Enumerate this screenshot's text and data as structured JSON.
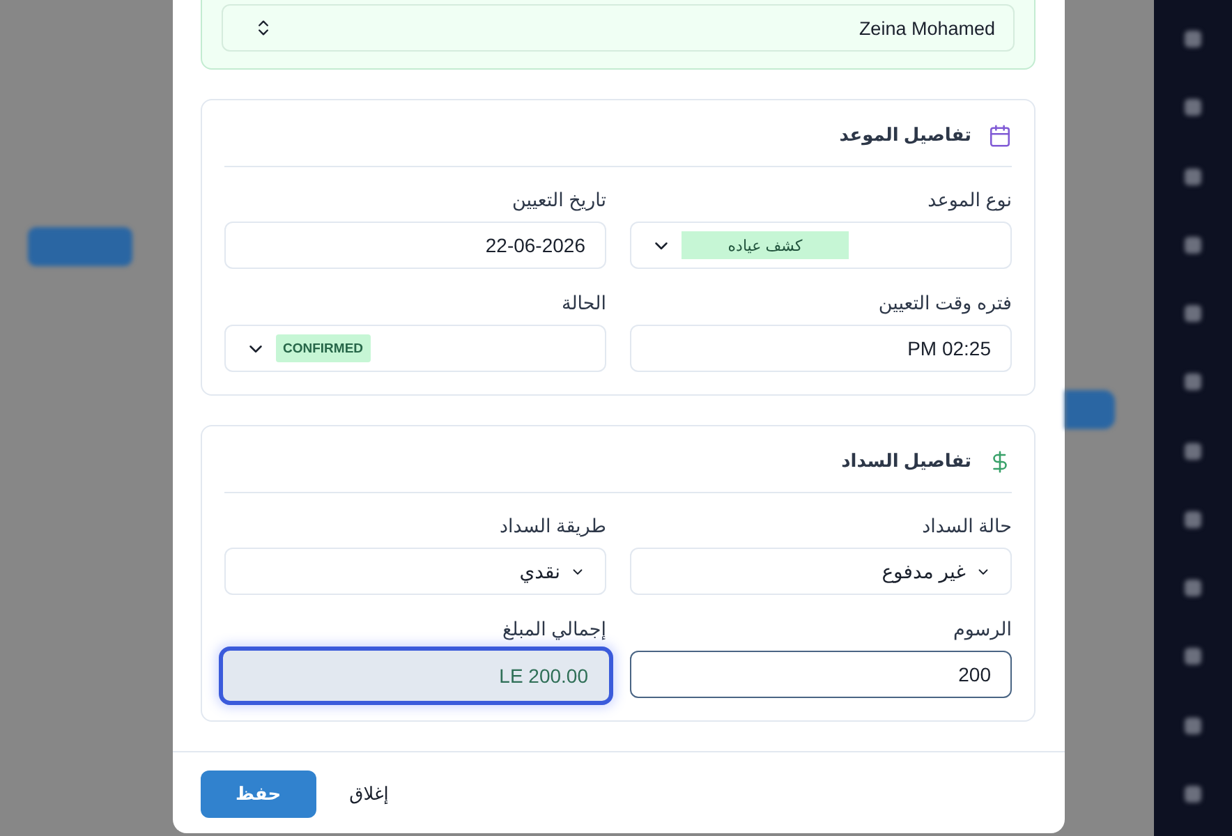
{
  "patient_select": {
    "value": "Zeina Mohamed"
  },
  "sections": [
    {
      "kind": "appointment",
      "title": "تفاصيل الموعد",
      "fields": [
        {
          "label": "نوع الموعد",
          "kind": "tag",
          "value": "كشف عياده",
          "readonly": false,
          "focused": false,
          "hovered": false
        },
        {
          "label": "تاريخ التعيين",
          "kind": "input",
          "value": "22-06-2026",
          "readonly": false,
          "focused": false,
          "hovered": false
        },
        {
          "label": "فتره وقت التعيين",
          "kind": "input",
          "value": "PM 02:25",
          "readonly": false,
          "focused": false,
          "hovered": false
        },
        {
          "label": "الحالة",
          "kind": "badge",
          "value": "CONFIRMED",
          "readonly": false,
          "focused": false,
          "hovered": false
        }
      ]
    },
    {
      "kind": "payment",
      "title": "تفاصيل السداد",
      "fields": [
        {
          "label": "حالة السداد",
          "kind": "select",
          "value": "غير مدفوع",
          "readonly": false,
          "focused": false,
          "hovered": false
        },
        {
          "label": "طريقة السداد",
          "kind": "select",
          "value": "نقدي",
          "readonly": false,
          "focused": false,
          "hovered": false
        },
        {
          "label": "الرسوم",
          "kind": "input",
          "value": "200",
          "readonly": false,
          "focused": false,
          "hovered": true
        },
        {
          "label": "إجمالي المبلغ",
          "kind": "input",
          "value": "LE 200.00",
          "readonly": true,
          "focused": true,
          "hovered": false
        }
      ]
    }
  ],
  "buttons": [
    {
      "label": "إغلاق",
      "kind": "ghost"
    },
    {
      "label": "حفظ",
      "kind": "primary"
    }
  ]
}
